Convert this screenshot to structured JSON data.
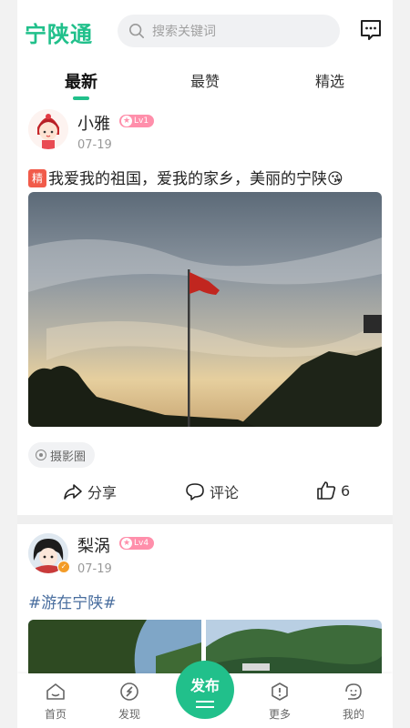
{
  "app": {
    "logo": "宁陕通",
    "brand_color": "#21c08b"
  },
  "search": {
    "placeholder": "搜索关键词"
  },
  "tabs": [
    {
      "label": "最新",
      "active": true
    },
    {
      "label": "最赞",
      "active": false
    },
    {
      "label": "精选",
      "active": false
    }
  ],
  "posts": [
    {
      "username": "小雅",
      "level": "Lv1",
      "date": "07-19",
      "badge": "精",
      "text": "我爱我的祖国，爱我的家乡，美丽的宁陕😘",
      "topic": "摄影圈",
      "actions": {
        "share": "分享",
        "comment": "评论",
        "likes": "6"
      }
    },
    {
      "username": "梨涡",
      "level": "Lv4",
      "date": "07-19",
      "text": "#游在宁陕#"
    }
  ],
  "bottom_nav": {
    "home": "首页",
    "discover": "发现",
    "publish": "发布",
    "more": "更多",
    "mine": "我的"
  }
}
